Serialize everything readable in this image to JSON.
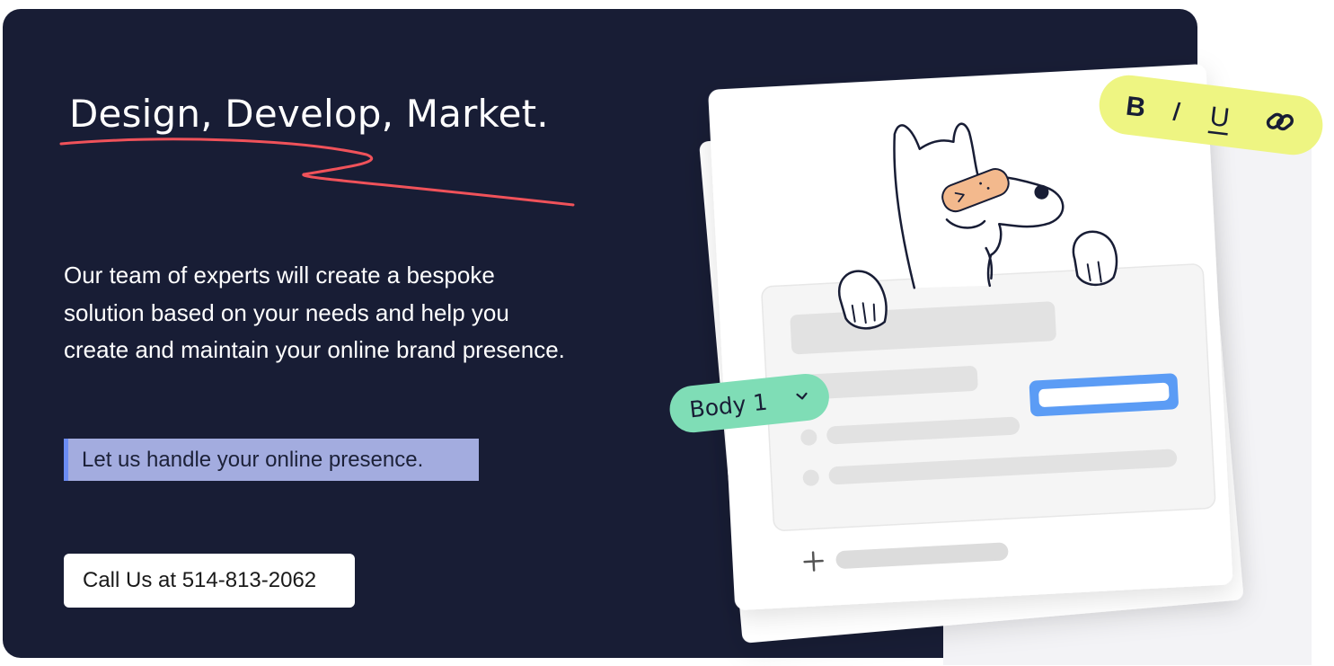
{
  "hero": {
    "title": "Design, Develop, Market.",
    "description": "Our team of experts will create a bespoke solution based on your needs and help you create and maintain your online brand presence.",
    "highlight": "Let us handle your online presence.",
    "cta_label": "Call Us at 514-813-2062"
  },
  "editor": {
    "toolbar": {
      "bold": "B",
      "italic": "I",
      "underline": "U"
    },
    "style_dropdown": {
      "selected": "Body 1"
    },
    "icons": [
      "link-icon",
      "chevron-down-icon",
      "plus-icon"
    ]
  },
  "colors": {
    "background": "#181d35",
    "scribble": "#f0525a",
    "highlight": "#a3acdf",
    "toolbar_pill": "#eef582",
    "dropdown_pill": "#7fddb6",
    "input_border": "#5b9cf5",
    "bandage": "#f3b98d"
  }
}
